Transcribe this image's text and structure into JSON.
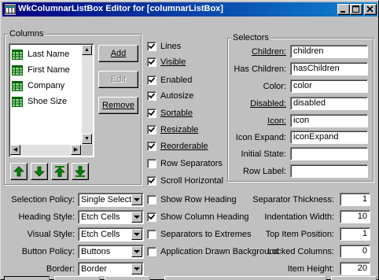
{
  "window": {
    "title": "WkColumnarListBox Editor for [columnarListBox]"
  },
  "columns": {
    "label": "Columns",
    "items": [
      "Last Name",
      "First Name",
      "Company",
      "Shoe Size"
    ],
    "add_label": "Add",
    "edit_label": "Edit",
    "remove_label": "Remove"
  },
  "checkboxes": [
    {
      "label": "Lines",
      "checked": true
    },
    {
      "label": "Visible",
      "checked": true
    },
    {
      "label": "Enabled",
      "checked": true
    },
    {
      "label": "Autosize",
      "checked": true
    },
    {
      "label": "Sortable",
      "checked": true
    },
    {
      "label": "Resizable",
      "checked": true
    },
    {
      "label": "Reorderable",
      "checked": true
    },
    {
      "label": "Row Separators",
      "checked": false
    },
    {
      "label": "Scroll Horizontal",
      "checked": true
    }
  ],
  "selectors": {
    "label": "Selectors",
    "rows": [
      {
        "label": "Children:",
        "value": "children"
      },
      {
        "label": "Has Children:",
        "value": "hasChildren"
      },
      {
        "label": "Color:",
        "value": "color"
      },
      {
        "label": "Disabled:",
        "value": "disabled"
      },
      {
        "label": "Icon:",
        "value": "icon"
      },
      {
        "label": "Icon Expand:",
        "value": "iconExpand"
      },
      {
        "label": "Initial State:",
        "value": ""
      },
      {
        "label": "Row Label:",
        "value": ""
      }
    ]
  },
  "policies": [
    {
      "label": "Selection Policy:",
      "value": "Single Select"
    },
    {
      "label": "Heading Style:",
      "value": "Etch Cells"
    },
    {
      "label": "Visual Style:",
      "value": "Etch Cells"
    },
    {
      "label": "Button Policy:",
      "value": "Buttons"
    },
    {
      "label": "Border:",
      "value": "Border"
    }
  ],
  "bottom_checks": [
    {
      "label": "Show Row Heading",
      "checked": false
    },
    {
      "label": "Show Column Heading",
      "checked": true
    },
    {
      "label": "Separators to Extremes",
      "checked": false
    },
    {
      "label": "Application Drawn Background",
      "checked": false
    }
  ],
  "numerics": [
    {
      "label": "Separator Thickness:",
      "value": "1"
    },
    {
      "label": "Indentation Width:",
      "value": "10"
    },
    {
      "label": "Top Item Position:",
      "value": "1"
    },
    {
      "label": "Locked Columns:",
      "value": "0"
    },
    {
      "label": "Item Height:",
      "value": "20"
    }
  ]
}
